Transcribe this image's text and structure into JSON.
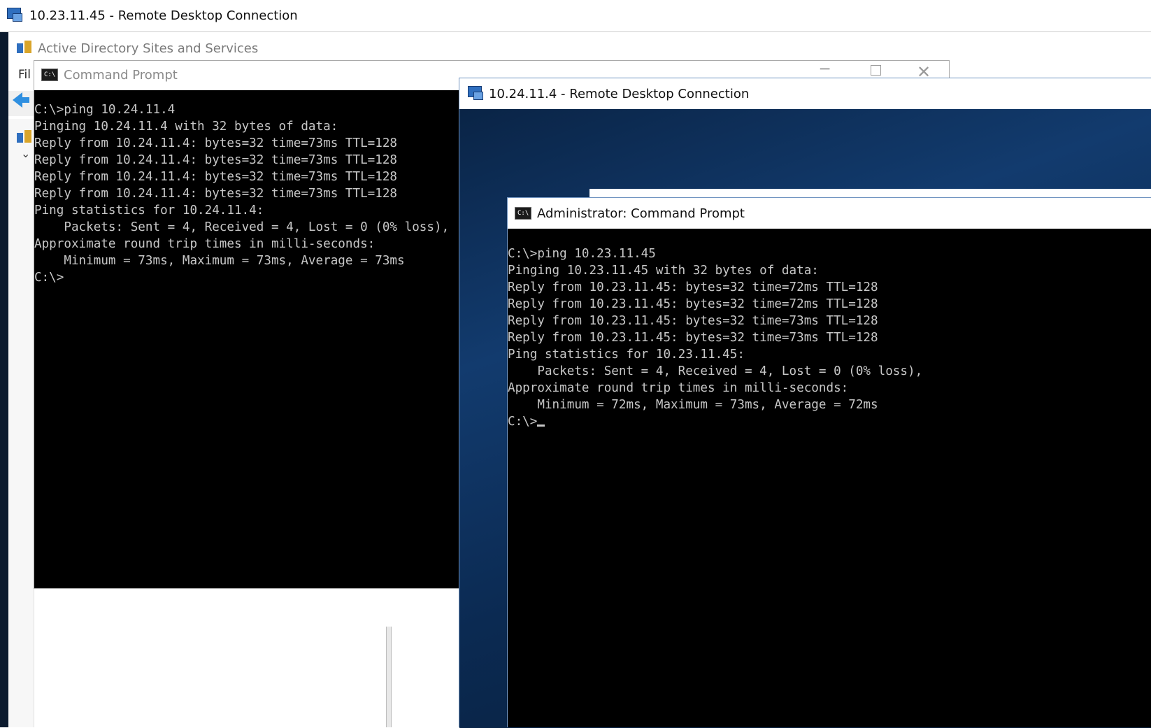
{
  "outer_window": {
    "title": "10.23.11.45 - Remote Desktop Connection"
  },
  "ad_window": {
    "title": "Active Directory Sites and Services",
    "menu_file": "Fil"
  },
  "cmd1": {
    "title": "Command Prompt",
    "lines": [
      "C:\\>ping 10.24.11.4",
      "",
      "Pinging 10.24.11.4 with 32 bytes of data:",
      "Reply from 10.24.11.4: bytes=32 time=73ms TTL=128",
      "Reply from 10.24.11.4: bytes=32 time=73ms TTL=128",
      "Reply from 10.24.11.4: bytes=32 time=73ms TTL=128",
      "Reply from 10.24.11.4: bytes=32 time=73ms TTL=128",
      "",
      "Ping statistics for 10.24.11.4:",
      "    Packets: Sent = 4, Received = 4, Lost = 0 (0% loss),",
      "Approximate round trip times in milli-seconds:",
      "    Minimum = 73ms, Maximum = 73ms, Average = 73ms",
      "",
      "C:\\>"
    ]
  },
  "rdp2": {
    "title": "10.24.11.4 - Remote Desktop Connection"
  },
  "cmd2": {
    "title": "Administrator: Command Prompt",
    "lines": [
      "C:\\>ping 10.23.11.45",
      "",
      "Pinging 10.23.11.45 with 32 bytes of data:",
      "Reply from 10.23.11.45: bytes=32 time=72ms TTL=128",
      "Reply from 10.23.11.45: bytes=32 time=72ms TTL=128",
      "Reply from 10.23.11.45: bytes=32 time=73ms TTL=128",
      "Reply from 10.23.11.45: bytes=32 time=73ms TTL=128",
      "",
      "Ping statistics for 10.23.11.45:",
      "    Packets: Sent = 4, Received = 4, Lost = 0 (0% loss),",
      "Approximate round trip times in milli-seconds:",
      "    Minimum = 72ms, Maximum = 73ms, Average = 72ms",
      "",
      "C:\\>"
    ]
  },
  "icons": {
    "rdp": "remote-desktop-icon",
    "ad": "ad-sites-icon",
    "cmd": "cmd-icon",
    "back": "back-arrow-icon",
    "cmd_glyph": "C:\\",
    "win_min": "─",
    "win_close": "✕",
    "tree_chevron": "⌄"
  }
}
